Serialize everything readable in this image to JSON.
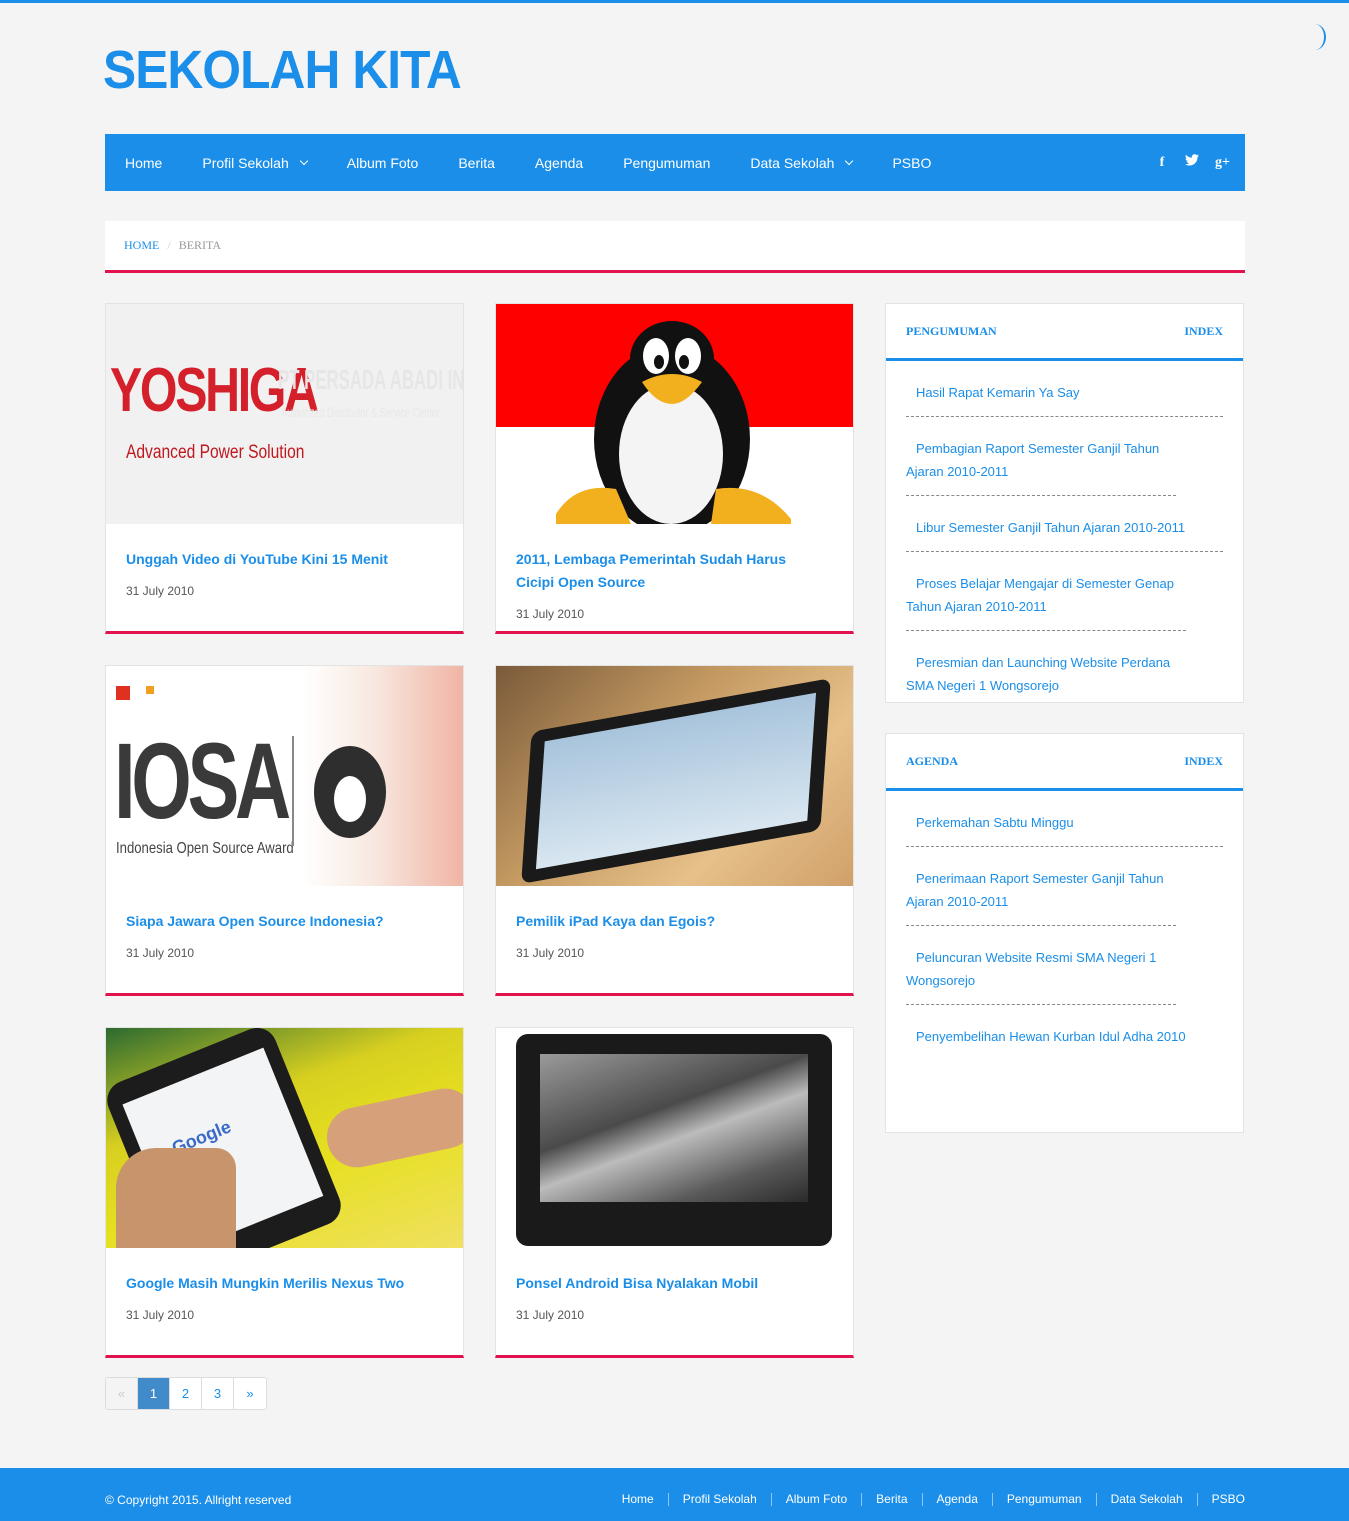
{
  "site": {
    "logo": "SEKOLAH KITA"
  },
  "nav": {
    "items": [
      {
        "label": "Home",
        "dropdown": false
      },
      {
        "label": "Profil Sekolah",
        "dropdown": true
      },
      {
        "label": "Album Foto",
        "dropdown": false
      },
      {
        "label": "Berita",
        "dropdown": false
      },
      {
        "label": "Agenda",
        "dropdown": false
      },
      {
        "label": "Pengumuman",
        "dropdown": false
      },
      {
        "label": "Data Sekolah",
        "dropdown": true
      },
      {
        "label": "PSBO",
        "dropdown": false
      }
    ],
    "social": {
      "facebook": "f",
      "twitter": "t",
      "googleplus": "g+"
    }
  },
  "breadcrumb": {
    "home": "HOME",
    "current": "BERITA"
  },
  "posts": [
    {
      "title": "Unggah Video di YouTube Kini 15 Menit",
      "date": "31 July 2010",
      "image": "yoshiga-logo"
    },
    {
      "title": "2011, Lembaga Pemerintah Sudah Harus Cicipi Open Source",
      "date": "31 July 2010",
      "image": "tux-penguin-flag"
    },
    {
      "title": "Siapa Jawara Open Source Indonesia?",
      "date": "31 July 2010",
      "image": "iosa-logo"
    },
    {
      "title": "Pemilik iPad Kaya dan Egois?",
      "date": "31 July 2010",
      "image": "tablet-photo"
    },
    {
      "title": "Google Masih Mungkin Merilis Nexus Two",
      "date": "31 July 2010",
      "image": "phone-google-photo"
    },
    {
      "title": "Ponsel Android Bisa Nyalakan Mobil",
      "date": "31 July 2010",
      "image": "motorola-phone"
    }
  ],
  "images": {
    "yoshiga": {
      "brand": "YOSHIGA",
      "tagline": "Advanced Power Solution",
      "company": "PT PERSADA ABADI INTERNUSA",
      "sub": "Authorized Distributor & Service Center"
    },
    "iosa": {
      "brand": "IOSA",
      "tagline": "Indonesia Open Source Award"
    },
    "google": {
      "brand": "Google"
    }
  },
  "pagination": {
    "prev": "«",
    "pages": [
      "1",
      "2",
      "3"
    ],
    "next": "»",
    "active": "1"
  },
  "widgets": {
    "pengumuman": {
      "title": "PENGUMUMAN",
      "index": "INDEX",
      "items": [
        "Hasil Rapat Kemarin Ya Say",
        "Pembagian Raport Semester Ganjil Tahun Ajaran 2010-2011",
        "Libur Semester Ganjil Tahun Ajaran 2010-2011",
        "Proses Belajar Mengajar di Semester Genap Tahun Ajaran 2010-2011",
        "Peresmian dan Launching Website Perdana SMA Negeri 1 Wongsorejo"
      ]
    },
    "agenda": {
      "title": "AGENDA",
      "index": "INDEX",
      "items": [
        "Perkemahan Sabtu Minggu",
        "Penerimaan Raport Semester Ganjil Tahun Ajaran 2010-2011",
        "Peluncuran Website Resmi SMA Negeri 1 Wongsorejo",
        "Penyembelihan Hewan Kurban Idul Adha 2010"
      ]
    }
  },
  "footer": {
    "copyright": "© Copyright 2015. Allright reserved",
    "links": [
      "Home",
      "Profil Sekolah",
      "Album Foto",
      "Berita",
      "Agenda",
      "Pengumuman",
      "Data Sekolah",
      "PSBO"
    ]
  },
  "colors": {
    "primary": "#1a8ee8",
    "accent": "#e0134f",
    "background": "#f4f4f4"
  }
}
